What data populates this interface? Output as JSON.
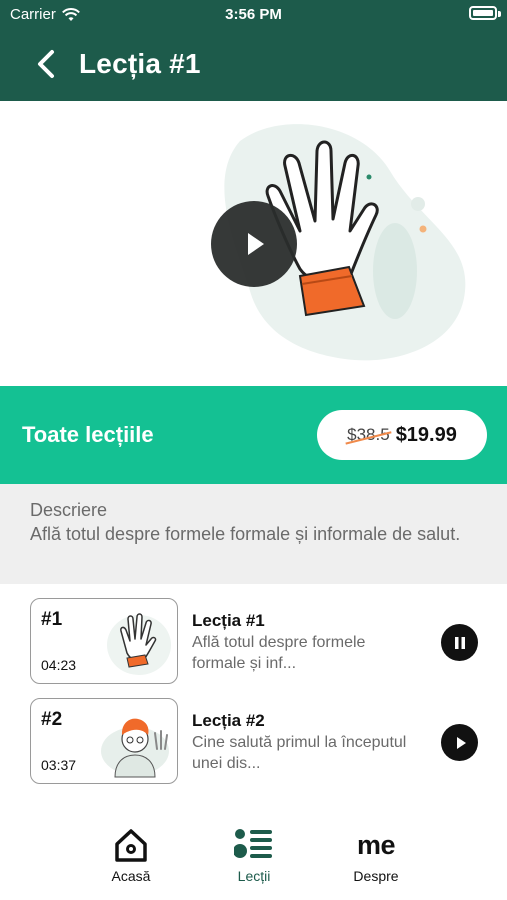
{
  "status_bar": {
    "carrier": "Carrier",
    "time": "3:56 PM"
  },
  "header": {
    "title": "Lecția #1"
  },
  "buy": {
    "label": "Toate lecțiile",
    "old_price": "$38.5",
    "new_price": "$19.99"
  },
  "description": {
    "heading": "Descriere",
    "text": "Află totul despre formele formale și informale de salut."
  },
  "lessons": [
    {
      "number": "#1",
      "duration": "04:23",
      "title": "Lecția #1",
      "subtitle": "Află totul despre formele formale și inf...",
      "state": "playing"
    },
    {
      "number": "#2",
      "duration": "03:37",
      "title": "Lecția #2",
      "subtitle": "Cine salută primul la începutul unei dis...",
      "state": "paused"
    }
  ],
  "tabs": [
    {
      "label": "Acasă",
      "icon": "home-icon"
    },
    {
      "label": "Lecții",
      "icon": "list-icon",
      "active": true
    },
    {
      "label": "Despre",
      "icon": "me-icon",
      "glyph": "me"
    }
  ],
  "colors": {
    "header": "#1d5b4b",
    "accent": "#14c193",
    "description_bg": "#efefef"
  }
}
